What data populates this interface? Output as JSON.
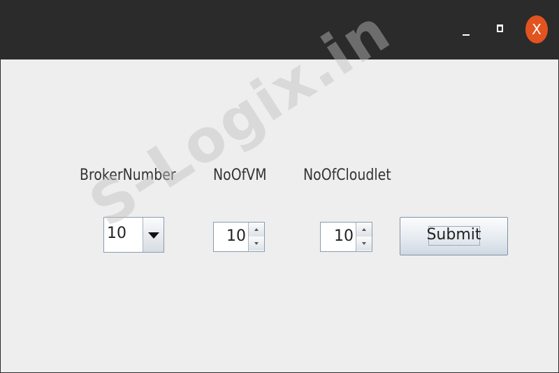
{
  "window": {
    "controls": {
      "minimize_icon": "minimize-icon",
      "maximize_icon": "maximize-icon",
      "close_label": "X",
      "close_color": "#e2531f"
    }
  },
  "form": {
    "broker_label": "BrokerNumber",
    "vm_label": "NoOfVM",
    "cloudlet_label": "NoOfCloudlet",
    "broker_combo": {
      "selected": "10"
    },
    "vm_spinner": {
      "value": "10"
    },
    "cloudlet_spinner": {
      "value": "10"
    },
    "submit_label": "Submit"
  },
  "watermark": "S-Logix.in"
}
